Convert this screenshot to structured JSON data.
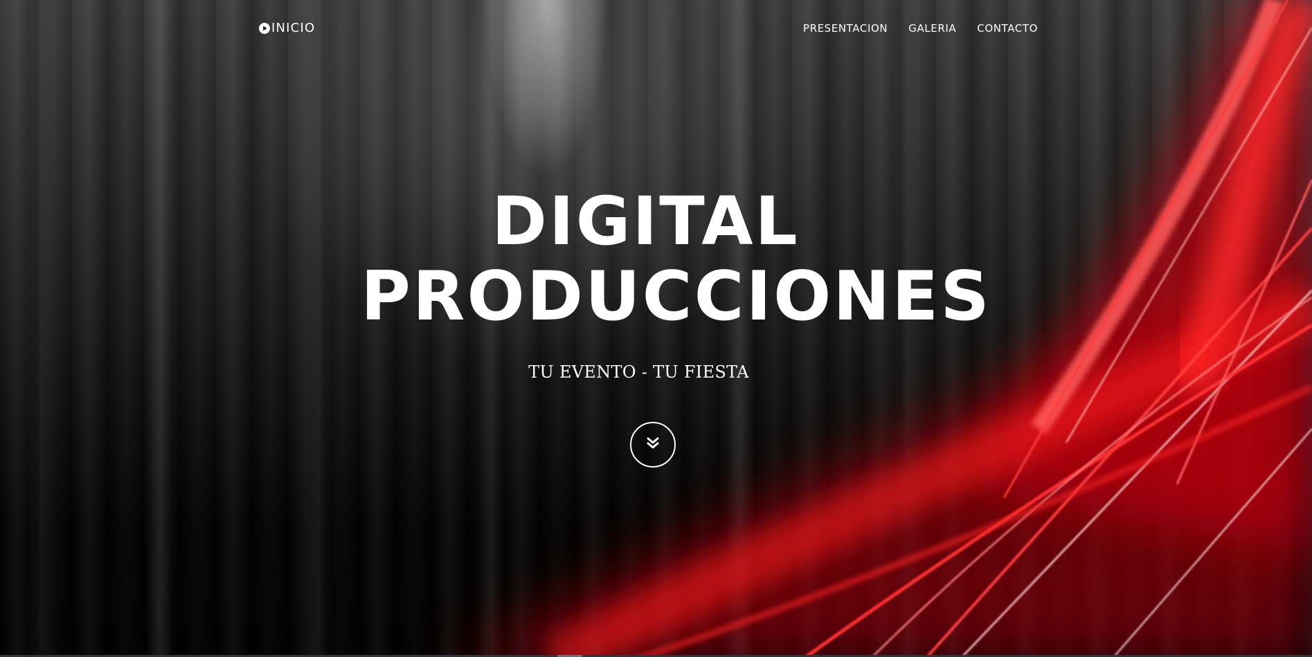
{
  "nav": {
    "brand": {
      "icon": "play-circle-icon",
      "label": "INICIO"
    },
    "links": [
      {
        "label": "PRESENTACION"
      },
      {
        "label": "GALERIA"
      },
      {
        "label": "CONTACTO"
      }
    ]
  },
  "hero": {
    "title_line1": "DIGITAL",
    "title_line2": "PRODUCCIONES",
    "tagline": "TU EVENTO - TU FIESTA",
    "scroll_icon": "double-chevron-down-icon"
  },
  "colors": {
    "text": "#ffffff",
    "accent": "#e30613",
    "background": "#000000"
  }
}
